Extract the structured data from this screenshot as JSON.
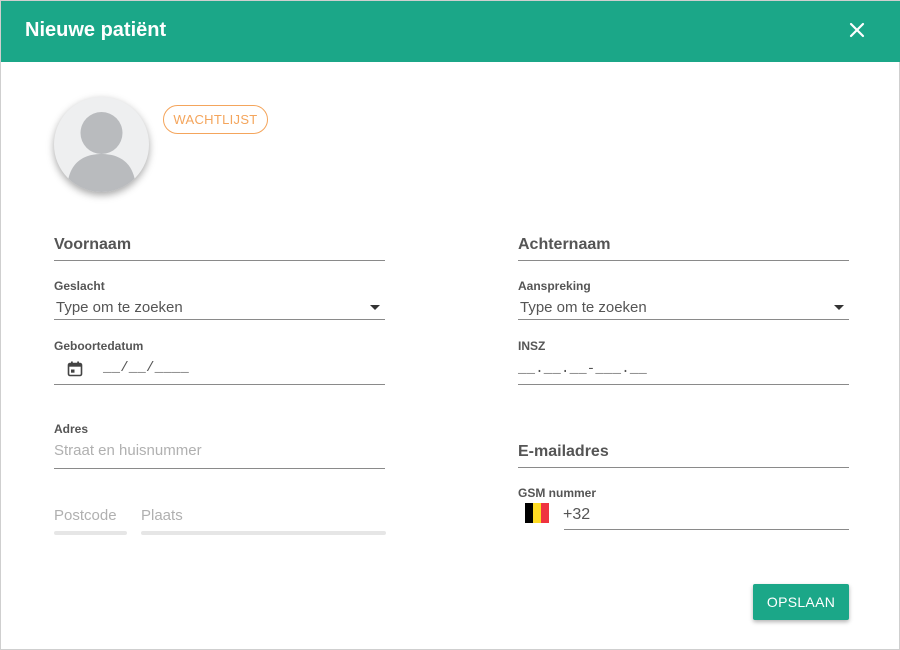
{
  "dialog": {
    "title": "Nieuwe patiënt",
    "close_icon": "close-icon",
    "header_color": "#1ba788"
  },
  "avatar": {
    "icon": "person-icon"
  },
  "badge": {
    "label": "WACHTLIJST",
    "color": "#f4a55c"
  },
  "form": {
    "voornaam": {
      "label": "Voornaam"
    },
    "achternaam": {
      "label": "Achternaam"
    },
    "geslacht": {
      "label": "Geslacht",
      "placeholder": "Type om te zoeken"
    },
    "aanspreking": {
      "label": "Aanspreking",
      "placeholder": "Type om te zoeken"
    },
    "geboortedatum": {
      "label": "Geboortedatum",
      "mask": "__/__/____",
      "icon": "calendar-icon"
    },
    "insz": {
      "label": "INSZ",
      "mask": "__.__.__-___.__"
    },
    "adres": {
      "label": "Adres",
      "placeholder": "Straat en huisnummer"
    },
    "email": {
      "label": "E-mailadres"
    },
    "postcode": {
      "placeholder": "Postcode"
    },
    "plaats": {
      "placeholder": "Plaats"
    },
    "gsm": {
      "label": "GSM nummer",
      "prefix": "+32",
      "flag": "belgium-flag-icon"
    }
  },
  "actions": {
    "save_label": "OPSLAAN"
  }
}
